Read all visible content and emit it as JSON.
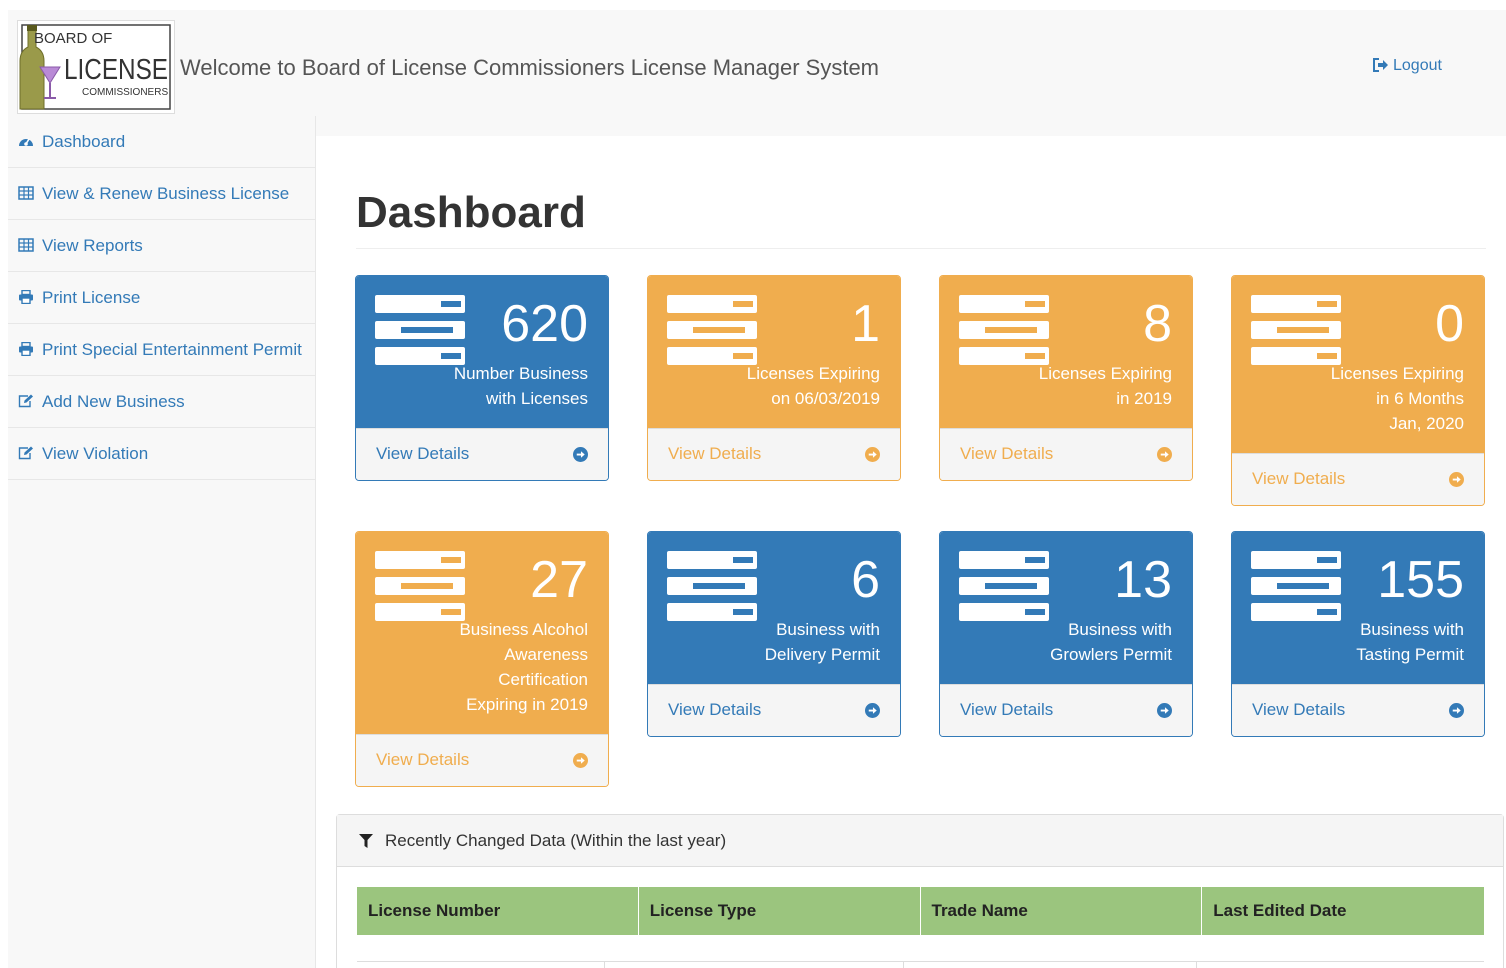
{
  "header": {
    "logo_text": "BOARD OF LICENSE COMMISSIONERS",
    "welcome": "Welcome to Board of License Commissioners License Manager System",
    "logout_label": "Logout"
  },
  "sidebar": {
    "items": [
      {
        "label": "Dashboard",
        "icon": "dashboard-icon"
      },
      {
        "label": "View & Renew Business License",
        "icon": "table-icon"
      },
      {
        "label": "View Reports",
        "icon": "table-icon"
      },
      {
        "label": "Print License",
        "icon": "print-icon"
      },
      {
        "label": "Print Special Entertainment Permit",
        "icon": "print-icon"
      },
      {
        "label": "Add New Business",
        "icon": "edit-icon"
      },
      {
        "label": "View Violation",
        "icon": "edit-icon"
      }
    ]
  },
  "main": {
    "title": "Dashboard",
    "panels": [
      {
        "value": "620",
        "label": "Number Business\nwith Licenses",
        "link": "View Details",
        "color": "blue"
      },
      {
        "value": "1",
        "label": "Licenses Expiring\non 06/03/2019",
        "link": "View Details",
        "color": "orange"
      },
      {
        "value": "8",
        "label": "Licenses Expiring\nin 2019",
        "link": "View Details",
        "color": "orange"
      },
      {
        "value": "0",
        "label": "Licenses Expiring\nin 6 Months\nJan, 2020",
        "link": "View Details",
        "color": "orange"
      },
      {
        "value": "27",
        "label": "Business Alcohol\nAwareness\nCertification\nExpiring in 2019",
        "link": "View Details",
        "color": "orange"
      },
      {
        "value": "6",
        "label": "Business with\nDelivery Permit",
        "link": "View Details",
        "color": "blue"
      },
      {
        "value": "13",
        "label": "Business with\nGrowlers Permit",
        "link": "View Details",
        "color": "blue"
      },
      {
        "value": "155",
        "label": "Business with\nTasting Permit",
        "link": "View Details",
        "color": "blue"
      }
    ],
    "recent": {
      "title": "Recently Changed Data (Within the last year)",
      "columns": [
        "License Number",
        "License Type",
        "Trade Name",
        "Last Edited Date"
      ]
    }
  },
  "colors": {
    "primary": "#337ab7",
    "warning": "#f0ad4e",
    "table_header": "#9bc57e"
  }
}
